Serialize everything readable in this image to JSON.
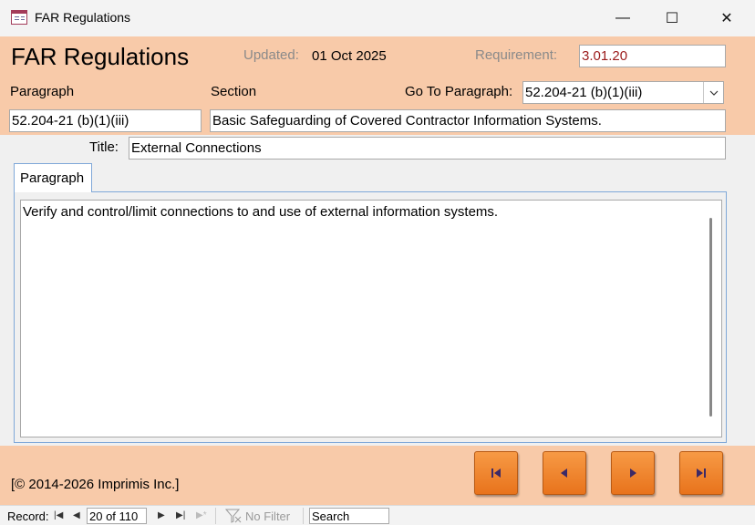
{
  "window": {
    "title": "FAR Regulations",
    "minimize_glyph": "—",
    "maximize_glyph": "☐",
    "close_glyph": "✕"
  },
  "header": {
    "form_title": "FAR Regulations",
    "updated_label": "Updated:",
    "updated_value": "01 Oct 2025",
    "requirement_label": "Requirement:",
    "requirement_value": "3.01.20",
    "paragraph_label": "Paragraph",
    "section_label": "Section",
    "goto_label": "Go To Paragraph:",
    "goto_value": "52.204-21 (b)(1)(iii)",
    "paragraph_value": "52.204-21 (b)(1)(iii)",
    "section_value": "Basic Safeguarding of Covered Contractor Information Systems.",
    "title_label": "Title:",
    "title_value": "External Connections"
  },
  "tabs": [
    {
      "label": "Paragraph"
    }
  ],
  "paragraph_text": "Verify and control/limit connections to and use of external information systems.",
  "footer": {
    "copyright": "[© 2014-2026 Imprimis Inc.]",
    "nav_buttons": [
      "first-record",
      "previous-record",
      "next-record",
      "last-record"
    ]
  },
  "statusbar": {
    "record_label": "Record:",
    "record_value": "20 of 110",
    "filter_label": "No Filter",
    "search_placeholder": "Search"
  },
  "colors": {
    "header_bg": "#f8caa9",
    "button_orange": "#f0842e",
    "requirement_text": "#9b1b1b",
    "tab_border": "#7fa8d8"
  }
}
